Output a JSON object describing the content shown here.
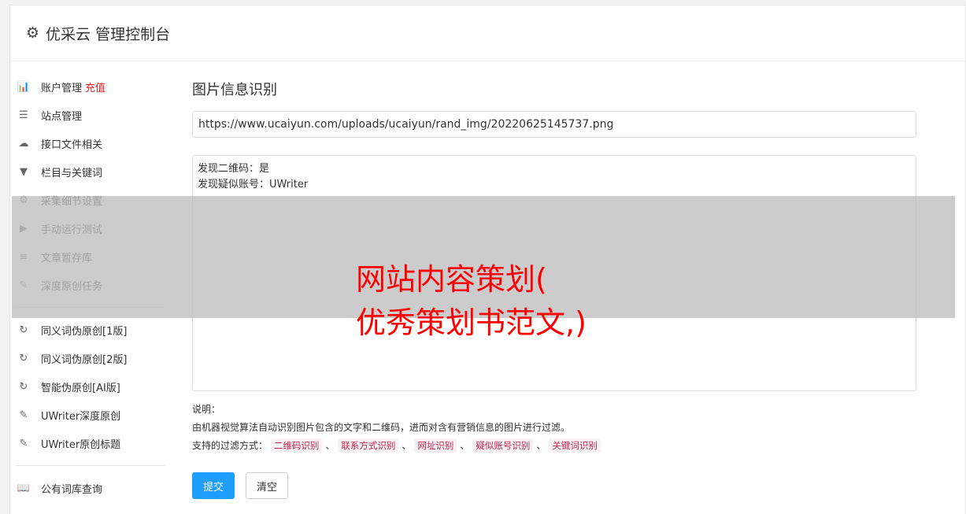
{
  "header": {
    "title": "优采云 管理控制台"
  },
  "sidebar": {
    "groups": [
      [
        {
          "label": "账户管理",
          "extra": "充值",
          "icon": "bar-chart-icon",
          "glyph": "📊"
        },
        {
          "label": "站点管理",
          "icon": "server-icon",
          "glyph": "☰"
        },
        {
          "label": "接口文件相关",
          "icon": "cloud-upload-icon",
          "glyph": "☁"
        },
        {
          "label": "栏目与关键词",
          "icon": "filter-icon",
          "glyph": "▼"
        },
        {
          "label": "采集细节设置",
          "icon": "cogs-icon",
          "glyph": "⚙"
        },
        {
          "label": "手动运行测试",
          "icon": "play-icon",
          "glyph": "▶"
        },
        {
          "label": "文章暂存库",
          "icon": "database-icon",
          "glyph": "≡"
        },
        {
          "label": "深度原创任务",
          "icon": "edit-icon",
          "glyph": "✎"
        }
      ],
      [
        {
          "label": "同义词伪原创[1版]",
          "icon": "refresh-icon",
          "glyph": "↻"
        },
        {
          "label": "同义词伪原创[2版]",
          "icon": "refresh-icon",
          "glyph": "↻"
        },
        {
          "label": "智能伪原创[AI版]",
          "icon": "refresh-icon",
          "glyph": "↻"
        },
        {
          "label": "UWriter深度原创",
          "icon": "edit-icon",
          "glyph": "✎"
        },
        {
          "label": "UWriter原创标题",
          "icon": "edit-icon",
          "glyph": "✎"
        }
      ],
      [
        {
          "label": "公有词库查询",
          "icon": "book-icon",
          "glyph": "📖"
        }
      ]
    ]
  },
  "main": {
    "title": "图片信息识别",
    "url_value": "https://www.ucaiyun.com/uploads/ucaiyun/rand_img/20220625145737.png",
    "result_lines": [
      "发现二维码：是",
      "发现疑似账号：UWriter"
    ],
    "desc_label": "说明：",
    "desc_text": "由机器视觉算法自动识别图片包含的文字和二维码，进而对含有营销信息的图片进行过滤。",
    "filter_label": "支持的过滤方式：",
    "filters": [
      "二维码识别",
      "联系方式识别",
      "网址识别",
      "疑似账号识别",
      "关键词识别"
    ],
    "filter_sep": "、",
    "submit_label": "提交",
    "clear_label": "清空"
  },
  "overlay": {
    "line1": "网站内容策划(",
    "line2": "优秀策划书范文,)"
  }
}
